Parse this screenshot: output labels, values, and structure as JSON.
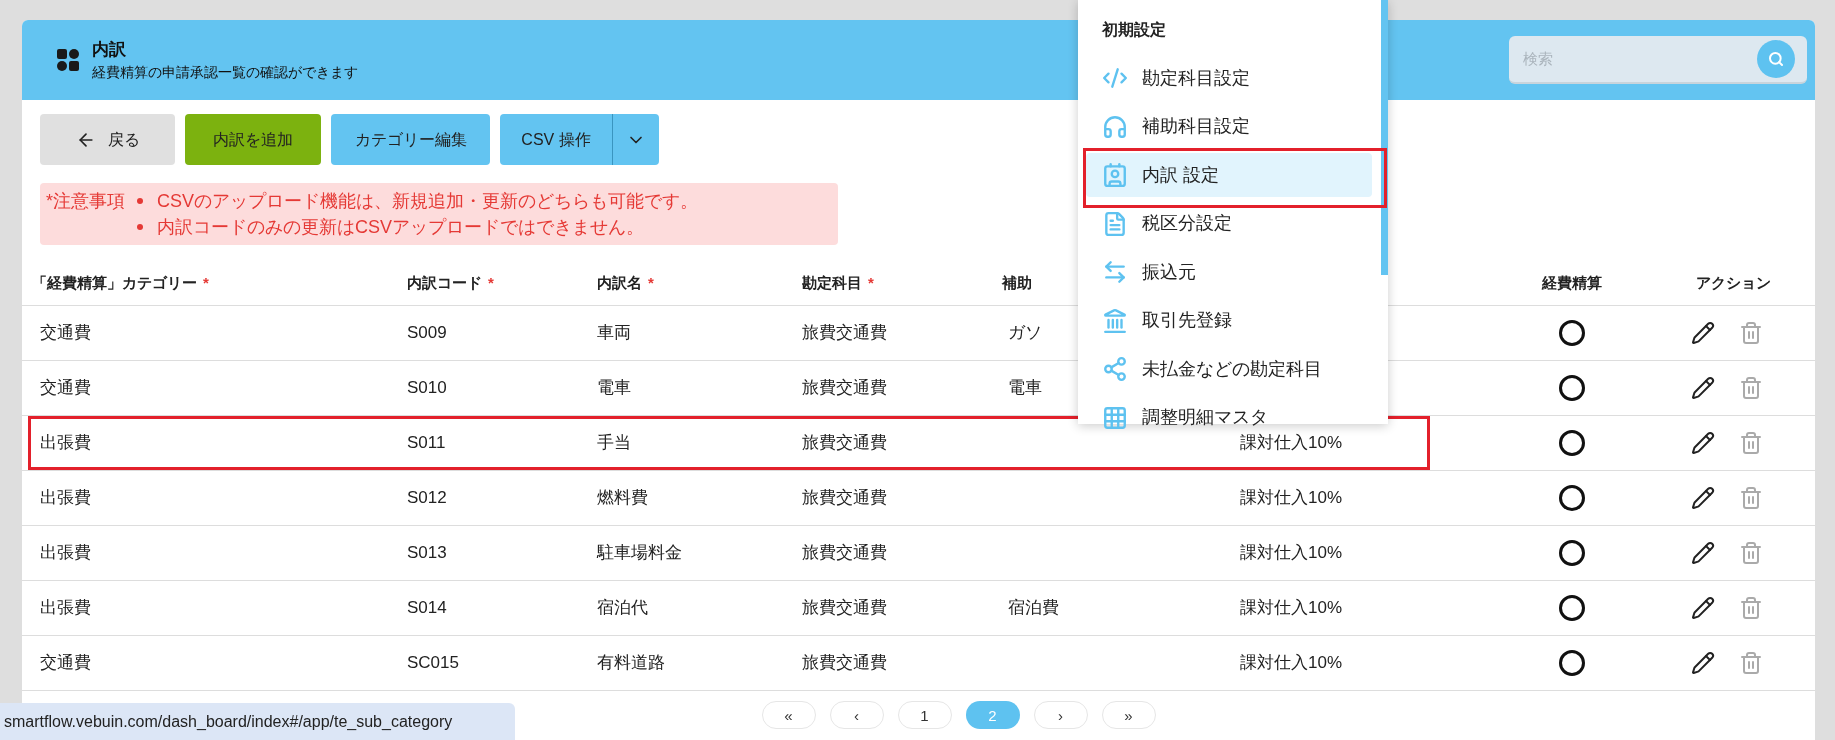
{
  "header": {
    "title": "内訳",
    "subtitle": "経費精算の申請承認一覧の確認ができます",
    "search": {
      "placeholder": "検索"
    }
  },
  "toolbar": [
    {
      "kind": "back",
      "label": "戻る"
    },
    {
      "kind": "add",
      "label": "内訳を追加"
    },
    {
      "kind": "primary",
      "label": "カテゴリー編集"
    },
    {
      "kind": "split",
      "label": "CSV 操作"
    }
  ],
  "notice": {
    "label": "*注意事項",
    "items": [
      "CSVのアップロード機能は、新規追加・更新のどちらも可能です。",
      "内訳コードのみの更新はCSVアップロードではできません。"
    ]
  },
  "table": {
    "columns": [
      {
        "label": "「経費精算」カテゴリー",
        "required_mark": "*"
      },
      {
        "label": "内訳コード",
        "required_mark": "*"
      },
      {
        "label": "内訳名",
        "required_mark": "*"
      },
      {
        "label": "勘定科目",
        "required_mark": "*"
      },
      {
        "label": "補助"
      },
      {
        "label": "経費精算"
      },
      {
        "label": "アクション"
      }
    ],
    "rows": [
      {
        "category": "交通費",
        "code": "S009",
        "name": "車両",
        "account": "旅費交通費",
        "sub": "ガソ",
        "keihi": true,
        "highlighted": false
      },
      {
        "category": "交通費",
        "code": "S010",
        "name": "電車",
        "account": "旅費交通費",
        "sub": "電車",
        "keihi": true,
        "highlighted": false
      },
      {
        "category": "出張費",
        "code": "S011",
        "name": "手当",
        "account": "旅費交通費",
        "tax": "課対仕入10%",
        "keihi": true,
        "highlighted": true
      },
      {
        "category": "出張費",
        "code": "S012",
        "name": "燃料費",
        "account": "旅費交通費",
        "tax": "課対仕入10%",
        "keihi": true,
        "highlighted": false
      },
      {
        "category": "出張費",
        "code": "S013",
        "name": "駐車場料金",
        "account": "旅費交通費",
        "tax": "課対仕入10%",
        "keihi": true,
        "highlighted": false
      },
      {
        "category": "出張費",
        "code": "S014",
        "name": "宿泊代",
        "account": "旅費交通費",
        "sub": "宿泊費",
        "tax": "課対仕入10%",
        "keihi": true,
        "highlighted": false
      },
      {
        "category": "交通費",
        "code": "SC015",
        "name": "有料道路",
        "account": "旅費交通費",
        "tax": "課対仕入10%",
        "keihi": true,
        "highlighted": false
      }
    ]
  },
  "pagination": [
    {
      "label": "«",
      "selected": false
    },
    {
      "label": "‹",
      "selected": false
    },
    {
      "label": "1",
      "selected": false
    },
    {
      "label": "2",
      "selected": true
    },
    {
      "label": "›",
      "selected": false
    },
    {
      "label": "»",
      "selected": false
    }
  ],
  "menu": {
    "title": "初期設定",
    "items": [
      {
        "kind": "code",
        "label": "勘定科目設定",
        "selected": false,
        "highlighted": false
      },
      {
        "kind": "headset",
        "label": "補助科目設定",
        "selected": false,
        "highlighted": false
      },
      {
        "kind": "contact",
        "label": "内訳 設定",
        "selected": true,
        "highlighted": true
      },
      {
        "kind": "document",
        "label": "税区分設定",
        "selected": false,
        "highlighted": false
      },
      {
        "kind": "transfer",
        "label": "振込元",
        "selected": false,
        "highlighted": false
      },
      {
        "kind": "bank",
        "label": "取引先登録",
        "selected": false,
        "highlighted": false
      },
      {
        "kind": "nodes",
        "label": "未払金などの勘定科目",
        "selected": false,
        "highlighted": false
      },
      {
        "kind": "grid",
        "label": "調整明細マスタ",
        "selected": false,
        "highlighted": false
      }
    ]
  },
  "status_bar": {
    "url": "smartflow.vebuin.com/dash_board/index#/app/te_sub_category"
  }
}
